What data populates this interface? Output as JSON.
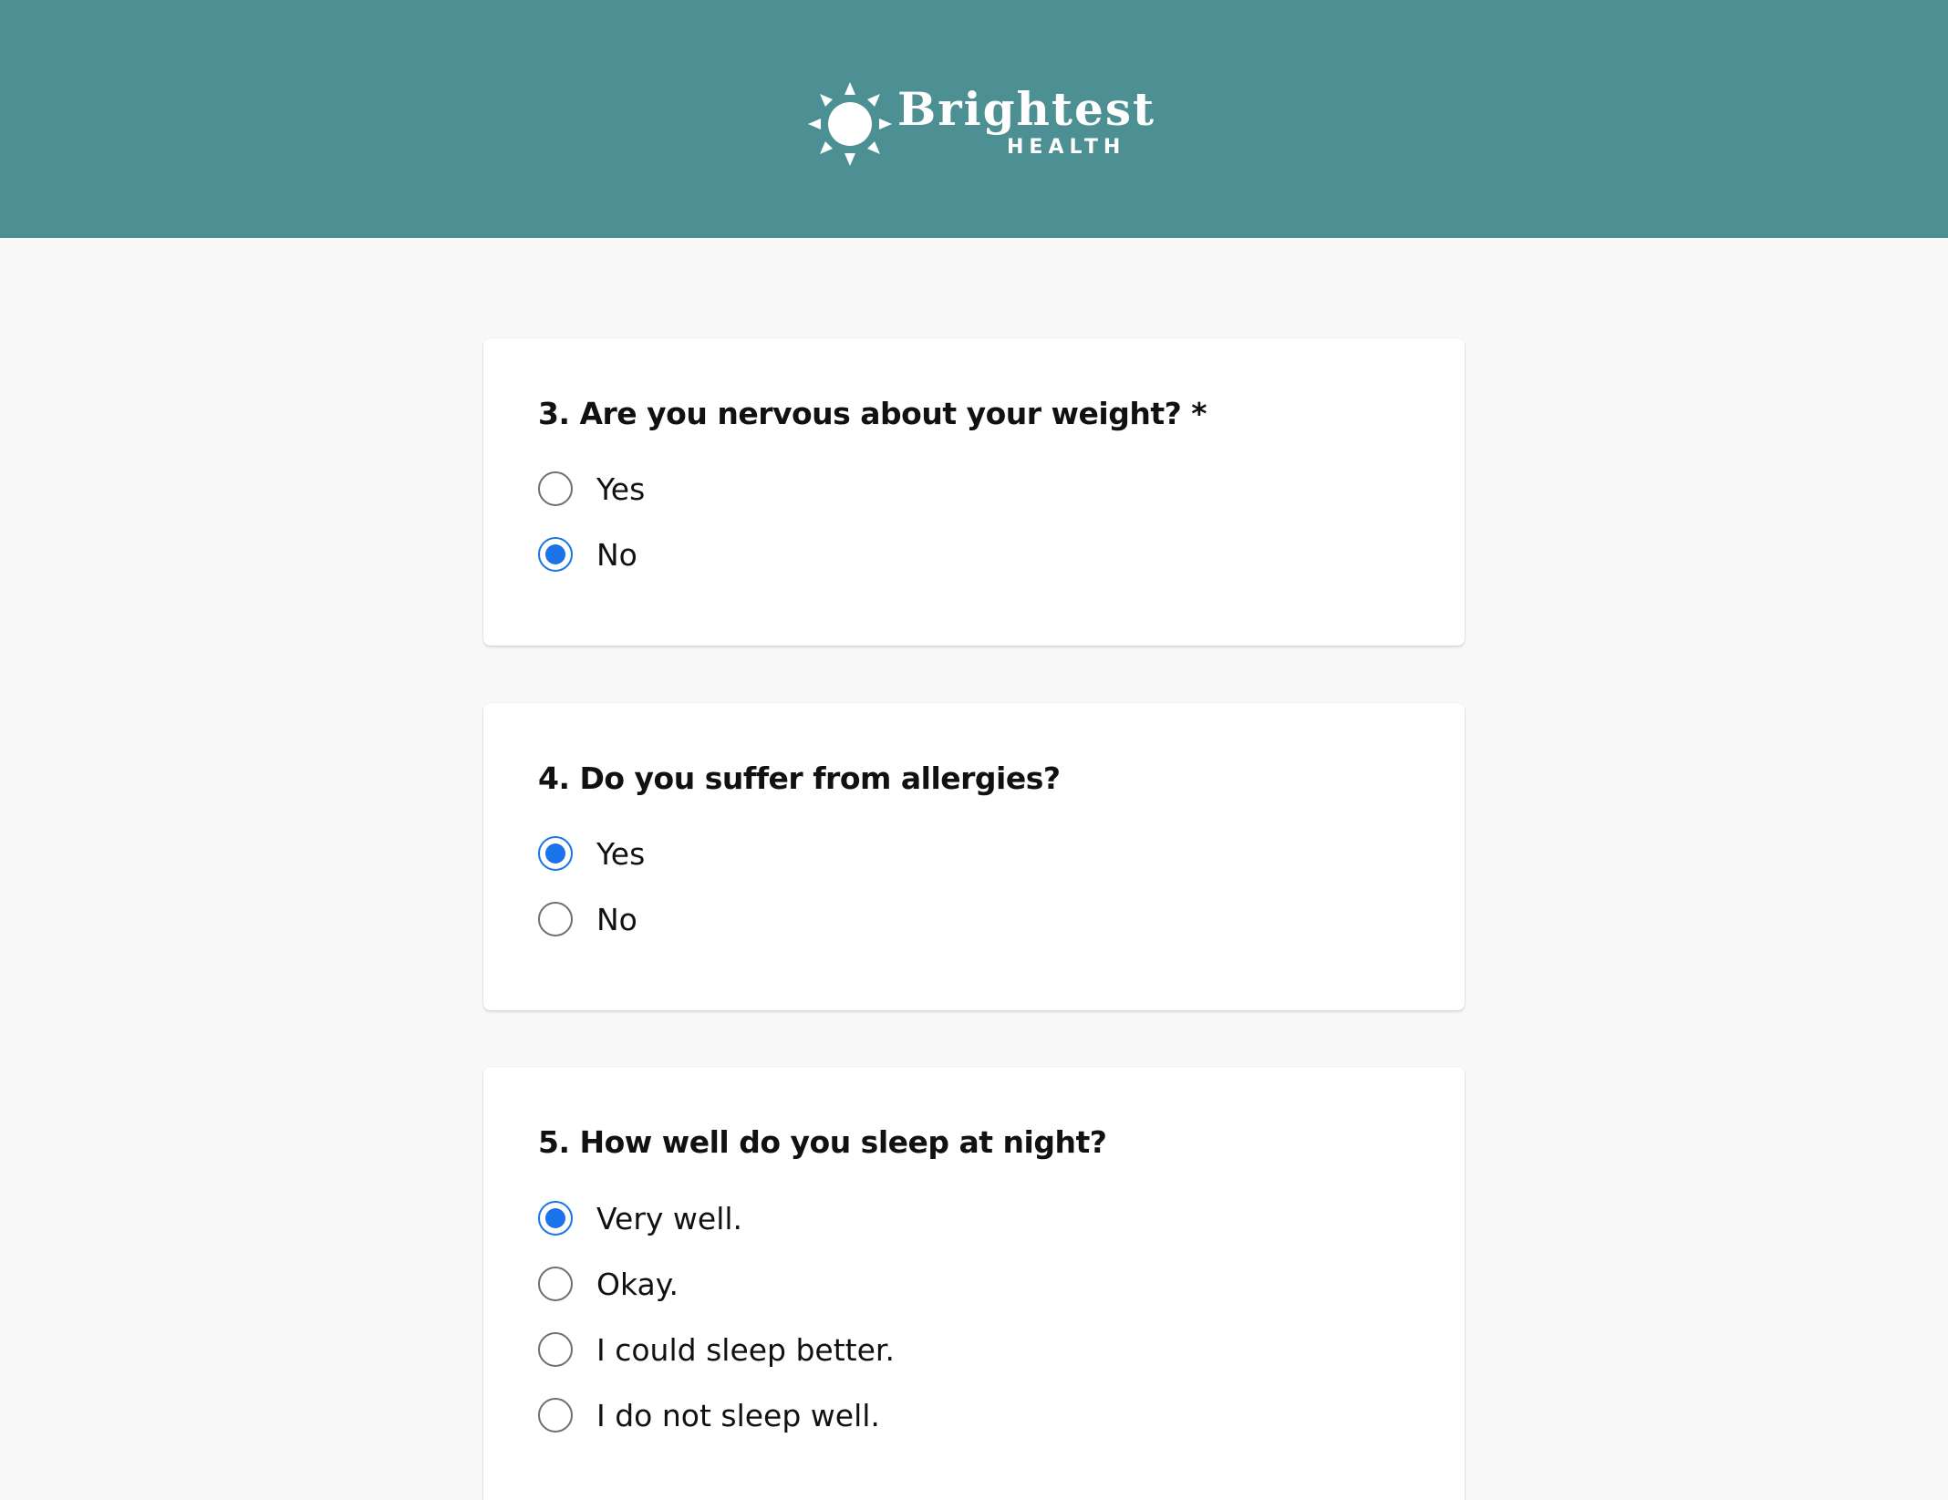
{
  "header": {
    "brand_name": "Brightest",
    "brand_subtitle": "HEALTH",
    "background_color": "#4c9093",
    "logo_icon": "sun-icon"
  },
  "colors": {
    "accent": "#1a73e8",
    "page_background": "#f9f9f9",
    "card_background": "#ffffff"
  },
  "questions": [
    {
      "title": "3. Are you nervous about your weight? *",
      "options": [
        {
          "label": "Yes",
          "selected": false
        },
        {
          "label": "No",
          "selected": true
        }
      ]
    },
    {
      "title": "4. Do you suffer from allergies?",
      "options": [
        {
          "label": "Yes",
          "selected": true
        },
        {
          "label": "No",
          "selected": false
        }
      ]
    },
    {
      "title": "5. How well do you sleep at night?",
      "options": [
        {
          "label": "Very well.",
          "selected": true
        },
        {
          "label": "Okay.",
          "selected": false
        },
        {
          "label": "I could sleep better.",
          "selected": false
        },
        {
          "label": "I do not sleep well.",
          "selected": false
        }
      ]
    }
  ]
}
